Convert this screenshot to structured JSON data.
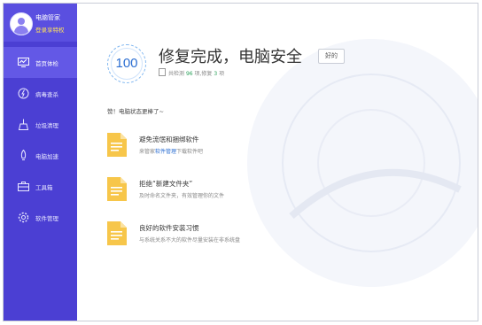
{
  "profile": {
    "name": "电脑管家",
    "login_text": "登录享特权"
  },
  "sidebar": {
    "items": [
      {
        "label": "首页体检",
        "icon": "health-check-icon",
        "active": true
      },
      {
        "label": "病毒查杀",
        "icon": "virus-scan-icon",
        "active": false
      },
      {
        "label": "垃圾清理",
        "icon": "junk-clean-icon",
        "active": false
      },
      {
        "label": "电脑加速",
        "icon": "speed-up-icon",
        "active": false
      },
      {
        "label": "工具箱",
        "icon": "toolbox-icon",
        "active": false
      },
      {
        "label": "软件管理",
        "icon": "software-manage-icon",
        "active": false
      }
    ]
  },
  "main": {
    "score": "100",
    "headline": "修复完成，电脑安全",
    "badge": "好的",
    "summary": {
      "prefix": "共检测",
      "checked": "96",
      "middle": "项,修复",
      "fixed": "3",
      "suffix": "项"
    },
    "praise": "赞！电脑状态更棒了~",
    "tips": [
      {
        "title": "避免流氓和捆绑软件",
        "desc_pre": "来管家",
        "desc_link": "软件管理",
        "desc_post": "下载软件吧"
      },
      {
        "title": "拒绝“新建文件夹”",
        "desc_pre": "及时命名文件夹，有效管理你的文件",
        "desc_link": "",
        "desc_post": ""
      },
      {
        "title": "良好的软件安装习惯",
        "desc_pre": "与系统关系不大的软件尽量安装在非系统盘",
        "desc_link": "",
        "desc_post": ""
      }
    ]
  },
  "colors": {
    "sidebar": "#4b3fd3",
    "sidebar_active": "#6358e6",
    "accent_blue": "#2d6fd2",
    "accent_green": "#2aa05a",
    "login_yellow": "#ffe25a",
    "file_icon": "#f7c64a"
  }
}
